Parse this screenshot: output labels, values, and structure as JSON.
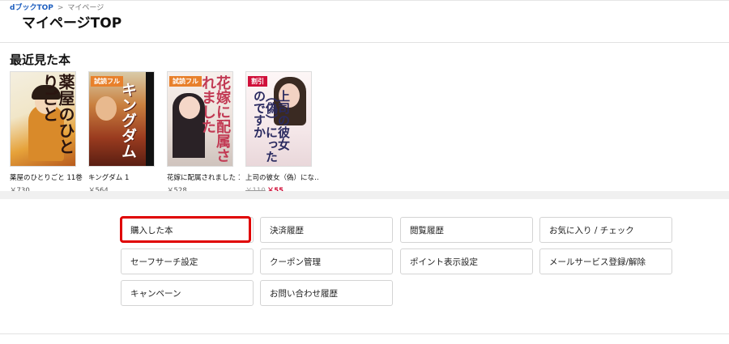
{
  "breadcrumb": {
    "home": "dブックTOP",
    "separator": ">",
    "current": "マイページ"
  },
  "page_title": "マイページTOP",
  "recent": {
    "title": "最近見た本",
    "books": [
      {
        "cover_title": "薬屋のひとりごと",
        "badge": "",
        "title": "薬屋のひとりごと 11巻",
        "price": "￥730",
        "old_price": "",
        "sale_price": ""
      },
      {
        "cover_title": "キングダム",
        "badge": "試読フル",
        "title": "キングダム 1",
        "price": "￥564",
        "old_price": "",
        "sale_price": ""
      },
      {
        "cover_title": "花嫁に配属されました",
        "badge": "試読フル",
        "title": "花嫁に配属されました 1",
        "price": "￥528",
        "old_price": "",
        "sale_price": ""
      },
      {
        "cover_title": "上司の彼女（偽）にったのですか",
        "badge": "割引",
        "title": "上司の彼女（偽）にな…",
        "price": "",
        "old_price": "￥110",
        "sale_price": "￥55"
      }
    ]
  },
  "menu": {
    "purchased": "購入した本",
    "payment_history": "決済履歴",
    "browse_history": "閲覧履歴",
    "favorites": "お気に入り / チェック",
    "safe_search": "セーフサーチ設定",
    "coupon": "クーポン管理",
    "point_display": "ポイント表示設定",
    "mail_service": "メールサービス登録/解除",
    "campaign": "キャンペーン",
    "inquiry_history": "お問い合わせ履歴"
  },
  "colors": {
    "highlight": "#e00000",
    "link": "#1f5fbf",
    "sale": "#d0103a"
  }
}
